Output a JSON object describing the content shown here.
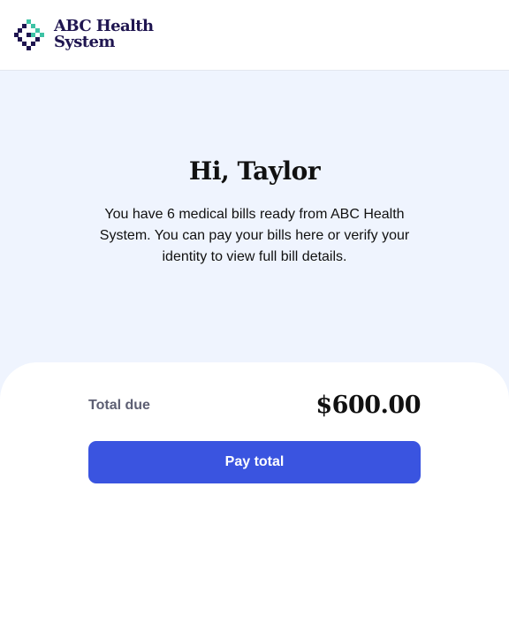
{
  "brand": {
    "name_line1": "ABC Health",
    "name_line2": "System",
    "color_text": "#1f1550",
    "color_mark_dark": "#1f1550",
    "color_mark_teal": "#3ec3a5",
    "logo_icon": "medical-cross-icon"
  },
  "hero": {
    "greeting": "Hi, Taylor",
    "message": "You have 6 medical bills ready from ABC Health System. You can pay your bills here or verify your identity to view full bill details.",
    "background": "#eff4fe"
  },
  "summary": {
    "total_label": "Total due",
    "total_amount": "$600.00",
    "pay_button_label": "Pay total",
    "button_color": "#3a54e0"
  }
}
